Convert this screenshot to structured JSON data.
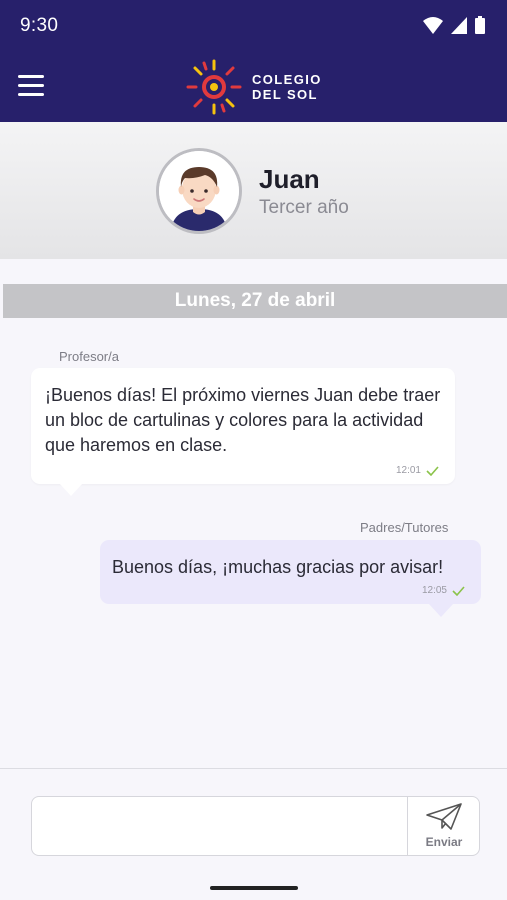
{
  "status_bar": {
    "time": "9:30"
  },
  "app_bar": {
    "logo_line1": "COLEGIO",
    "logo_line2": "DEL SOL",
    "logo_tagline": "",
    "brand_color": "#27206b"
  },
  "profile": {
    "name": "Juan",
    "grade": "Tercer año"
  },
  "date_separator": "Lunes, 27 de abril",
  "messages": [
    {
      "sender": "Profesor/a",
      "text": "¡Buenos días! El próximo viernes Juan debe traer un bloc de cartulinas y colores para la actividad que haremos en clase.",
      "time": "12:01",
      "status_icon": "check-icon"
    },
    {
      "sender": "Padres/Tutores",
      "text": "Buenos días, ¡muchas gracias por avisar!",
      "time": "12:05",
      "status_icon": "check-icon"
    }
  ],
  "composer": {
    "value": "",
    "placeholder": "",
    "send_label": "Enviar"
  },
  "colors": {
    "outgoing_bubble": "#ebe8fb",
    "incoming_bubble": "#ffffff",
    "check": "#8bc34a"
  }
}
